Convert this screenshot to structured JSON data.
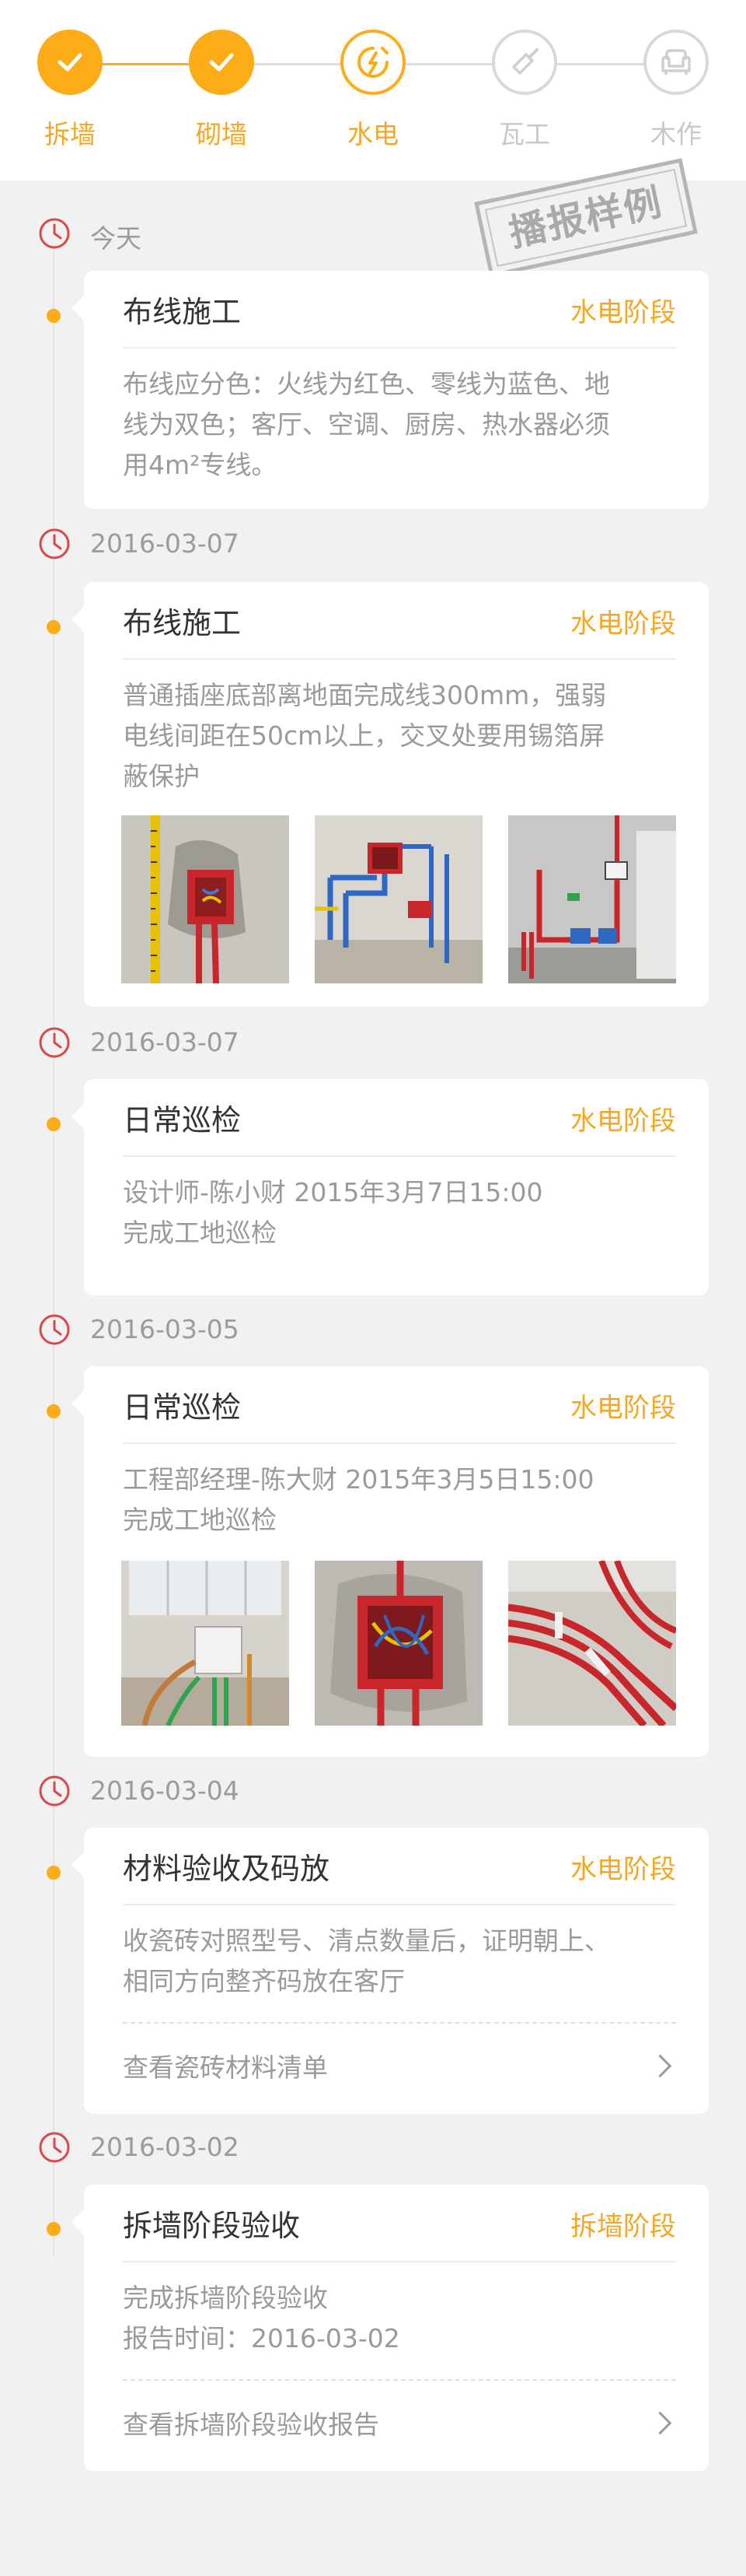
{
  "colors": {
    "accent": "#fbac16",
    "tag": "#f5a623",
    "inactive": "#d0d0d0",
    "clock": "#d9484b"
  },
  "stepper": {
    "steps": [
      {
        "label": "拆墙",
        "state": "done",
        "icon": "check-icon"
      },
      {
        "label": "砌墙",
        "state": "done",
        "icon": "check-icon"
      },
      {
        "label": "水电",
        "state": "active",
        "icon": "plug-icon"
      },
      {
        "label": "瓦工",
        "state": "todo",
        "icon": "trowel-icon"
      },
      {
        "label": "木作",
        "state": "todo",
        "icon": "sofa-icon"
      }
    ]
  },
  "stamp": {
    "text": "播报样例"
  },
  "timeline": [
    {
      "date": "今天",
      "title": "布线施工",
      "tag": "水电阶段",
      "lines": [
        "布线应分色：火线为红色、零线为蓝色、地",
        "线为双色；客厅、空调、厨房、热水器必须",
        "用4m²专线。"
      ]
    },
    {
      "date": "2016-03-07",
      "title": "布线施工",
      "tag": "水电阶段",
      "lines": [
        "普通插座底部离地面完成线300mm，强弱",
        "电线间距在50cm以上，交叉处要用锡箔屏",
        "蔽保护"
      ]
    },
    {
      "date": "2016-03-07",
      "title": "日常巡检",
      "tag": "水电阶段",
      "lines": [
        "设计师-陈小财 2015年3月7日15:00",
        "完成工地巡检"
      ]
    },
    {
      "date": "2016-03-05",
      "title": "日常巡检",
      "tag": "水电阶段",
      "lines": [
        "工程部经理-陈大财 2015年3月5日15:00",
        "完成工地巡检"
      ]
    },
    {
      "date": "2016-03-04",
      "title": "材料验收及码放",
      "tag": "水电阶段",
      "lines": [
        "收瓷砖对照型号、清点数量后，证明朝上、",
        "相同方向整齐码放在客厅"
      ],
      "link": "查看瓷砖材料清单"
    },
    {
      "date": "2016-03-02",
      "title": "拆墙阶段验收",
      "tag": "拆墙阶段",
      "lines": [
        "完成拆墙阶段验收",
        "报告时间：2016-03-02"
      ],
      "link": "查看拆墙阶段验收报告"
    }
  ]
}
